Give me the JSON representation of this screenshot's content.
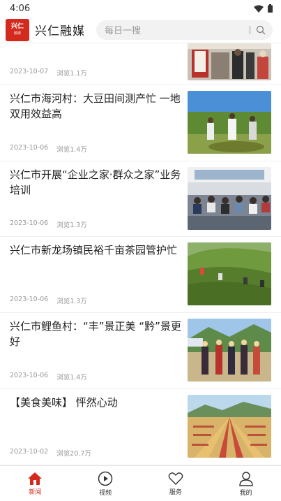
{
  "status_bar": {
    "time": "4:06"
  },
  "header": {
    "logo_text": "兴仁",
    "logo_sub": "融媒",
    "app_name": "兴仁融媒",
    "search_placeholder": "每日一搜"
  },
  "news": [
    {
      "title": "",
      "date": "2023-10-07",
      "views": "浏览1.1万"
    },
    {
      "title": "兴仁市海河村：大豆田间测产忙 一地双用效益高",
      "date": "2023-10-06",
      "views": "浏览1.4万"
    },
    {
      "title": "兴仁市开展“企业之家·群众之家”业务培训",
      "date": "2023-10-06",
      "views": "浏览1.3万"
    },
    {
      "title": "兴仁市新龙场镇民裕千亩茶园管护忙",
      "date": "2023-10-06",
      "views": "浏览1.3万"
    },
    {
      "title": "兴仁市鲤鱼村：“丰”景正美 “黔”景更好",
      "date": "2023-10-06",
      "views": "浏览1.4万"
    },
    {
      "title": "【美食美味】 怦然心动",
      "date": "2023-10-02",
      "views": "浏览20.7万"
    }
  ],
  "tabs": [
    {
      "label": "新闻",
      "icon": "home-icon",
      "active": true
    },
    {
      "label": "视频",
      "icon": "play-icon",
      "active": false
    },
    {
      "label": "服务",
      "icon": "heart-icon",
      "active": false
    },
    {
      "label": "我的",
      "icon": "user-icon",
      "active": false
    }
  ],
  "colors": {
    "accent": "#d42a1e"
  }
}
